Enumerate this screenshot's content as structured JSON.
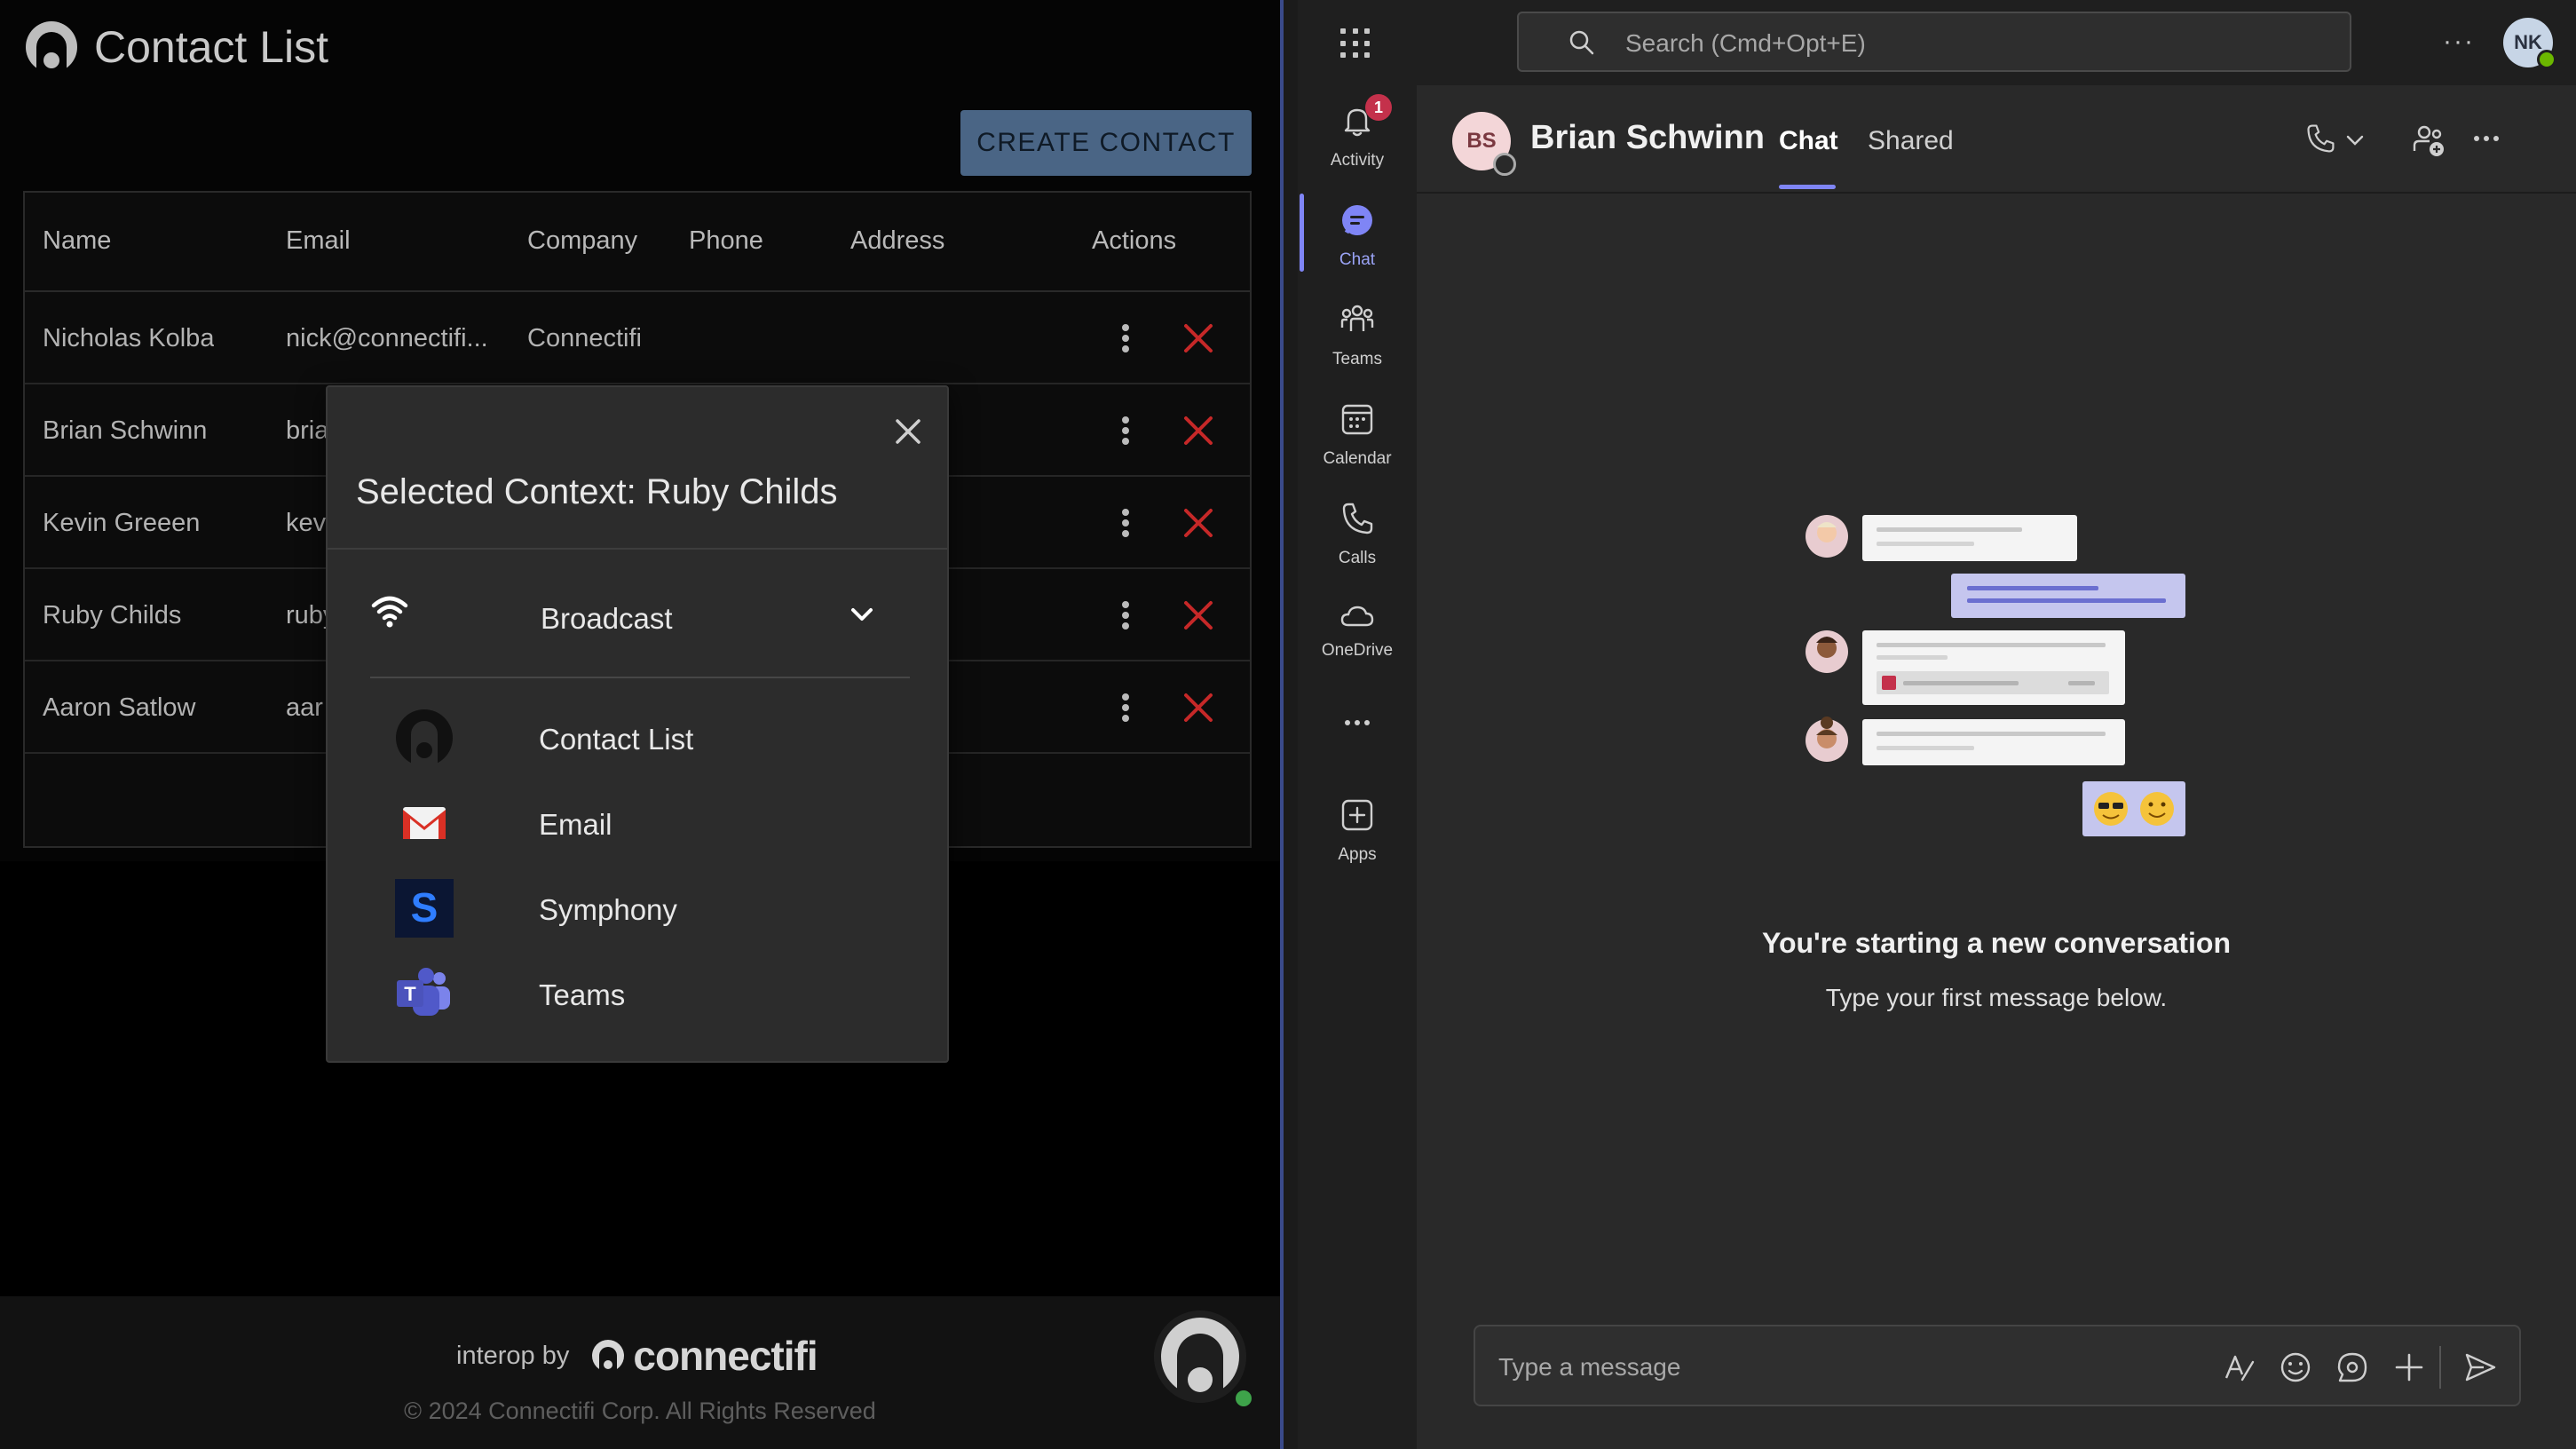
{
  "left_app": {
    "title": "Contact List",
    "create_button": "CREATE CONTACT",
    "columns": [
      "Name",
      "Email",
      "Company",
      "Phone",
      "Address",
      "Actions"
    ],
    "rows": [
      {
        "name": "Nicholas Kolba",
        "email": "nick@connectifi...",
        "company": "Connectifi"
      },
      {
        "name": "Brian Schwinn",
        "email": "bria",
        "company": ""
      },
      {
        "name": "Kevin Greeen",
        "email": "kev",
        "company": ""
      },
      {
        "name": "Ruby Childs",
        "email": "ruby",
        "company": ""
      },
      {
        "name": "Aaron Satlow",
        "email": "aar",
        "company": ""
      }
    ],
    "footer": {
      "interop_by": "interop by",
      "brand": "connectifi",
      "copyright": "© 2024 Connectifi Corp. All Rights Reserved"
    }
  },
  "modal": {
    "title": "Selected Context: Ruby Childs",
    "broadcast_label": "Broadcast",
    "apps": [
      "Contact List",
      "Email",
      "Symphony",
      "Teams"
    ]
  },
  "teams": {
    "search_placeholder": "Search (Cmd+Opt+E)",
    "user_initials": "NK",
    "rail": {
      "activity": "Activity",
      "activity_badge": "1",
      "chat": "Chat",
      "teams": "Teams",
      "calendar": "Calendar",
      "calls": "Calls",
      "onedrive": "OneDrive",
      "apps": "Apps"
    },
    "chat": {
      "contact_initials": "BS",
      "contact_name": "Brian Schwinn",
      "tab_chat": "Chat",
      "tab_shared": "Shared",
      "empty_title": "You're starting a new conversation",
      "empty_subtitle": "Type your first message below.",
      "composer_placeholder": "Type a message"
    }
  }
}
